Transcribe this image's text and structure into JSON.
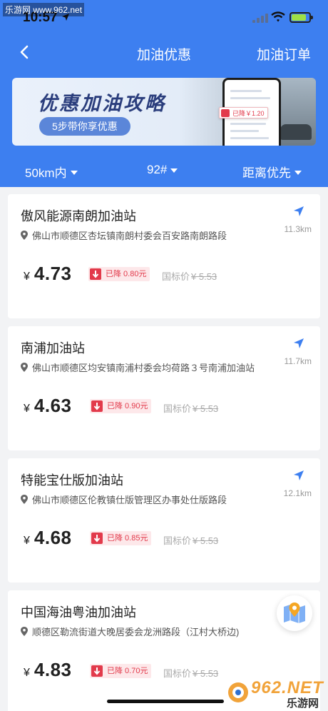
{
  "watermark_top": "乐游网 www.962.net",
  "status": {
    "time": "10:57"
  },
  "nav": {
    "title": "加油优惠",
    "right_label": "加油订单"
  },
  "banner": {
    "title": "优惠加油攻略",
    "pill": "5步带你享优惠",
    "phone_badge": "已降￥1.20"
  },
  "filters": [
    {
      "label": "50km内"
    },
    {
      "label": "92#"
    },
    {
      "label": "距离优先"
    }
  ],
  "stations": [
    {
      "name": "傲风能源南朗加油站",
      "address": "佛山市顺德区杏坛镇南朗村委会百安路南朗路段",
      "distance": "11.3km",
      "currency": "¥",
      "price": "4.73",
      "discount": "已降 0.80元",
      "std_label": "国标价",
      "std_price": "¥ 5.53"
    },
    {
      "name": "南浦加油站",
      "address": "佛山市顺德区均安镇南浦村委会均荷路３号南浦加油站",
      "distance": "11.7km",
      "currency": "¥",
      "price": "4.63",
      "discount": "已降 0.90元",
      "std_label": "国标价",
      "std_price": "¥ 5.53"
    },
    {
      "name": "特能宝仕版加油站",
      "address": "佛山市顺德区伦教镇仕版管理区办事处仕版路段",
      "distance": "12.1km",
      "currency": "¥",
      "price": "4.68",
      "discount": "已降 0.85元",
      "std_label": "国标价",
      "std_price": "¥ 5.53"
    },
    {
      "name": "中国海油粤油加油站",
      "address": "顺德区勒流街道大晚居委会龙洲路段（江村大桥边)",
      "distance": "",
      "currency": "¥",
      "price": "4.83",
      "discount": "已降 0.70元",
      "std_label": "国标价",
      "std_price": "¥ 5.53"
    }
  ],
  "watermark_br": {
    "main": "962.NET",
    "sub": "乐游网"
  },
  "colors": {
    "primary": "#3d7ff0",
    "discount": "#e23a4b",
    "discount_bg": "#fde8ea"
  }
}
